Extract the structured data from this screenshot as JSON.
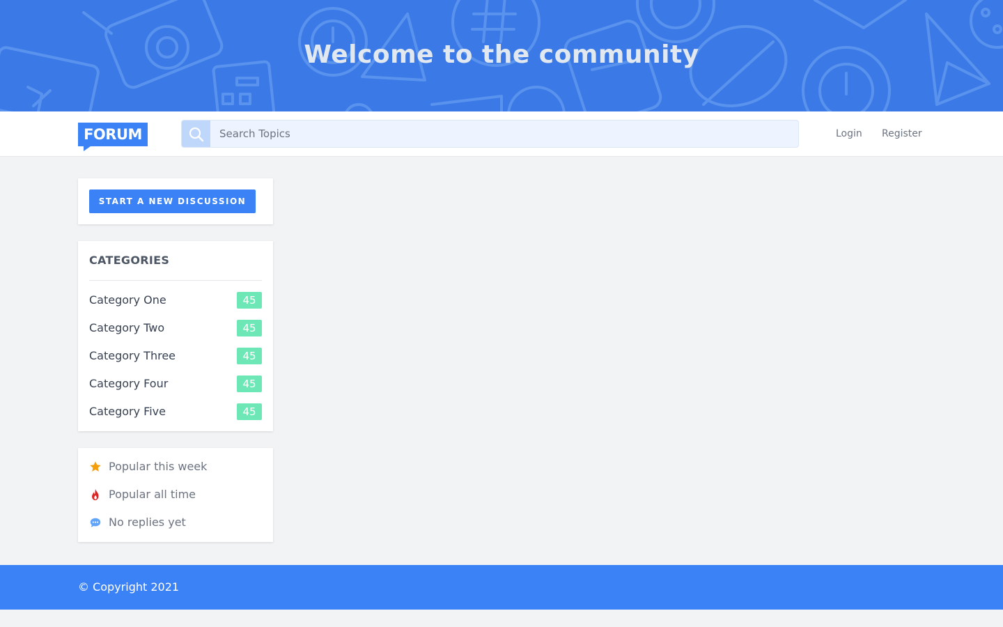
{
  "hero": {
    "title": "Welcome to the community"
  },
  "navbar": {
    "logo_text": "FORUM",
    "search_placeholder": "Search Topics",
    "login_label": "Login",
    "register_label": "Register"
  },
  "sidebar": {
    "start_button_label": "START A NEW DISCUSSION",
    "categories_title": "CATEGORIES",
    "categories": [
      {
        "label": "Category One",
        "count": "45"
      },
      {
        "label": "Category Two",
        "count": "45"
      },
      {
        "label": "Category Three",
        "count": "45"
      },
      {
        "label": "Category Four",
        "count": "45"
      },
      {
        "label": "Category Five",
        "count": "45"
      }
    ],
    "filters": [
      {
        "label": "Popular this week",
        "icon": "star-icon",
        "color": "#f59e0b"
      },
      {
        "label": "Popular all time",
        "icon": "fire-icon",
        "color": "#dc2626"
      },
      {
        "label": "No replies yet",
        "icon": "chat-bubble-icon",
        "color": "#60a5fa"
      }
    ]
  },
  "footer": {
    "copyright": "© Copyright 2021"
  },
  "colors": {
    "hero_background": "#3b7ae6",
    "primary": "#3b82f6",
    "badge": "#6ee7b7",
    "page_background": "#f2f3f5"
  }
}
